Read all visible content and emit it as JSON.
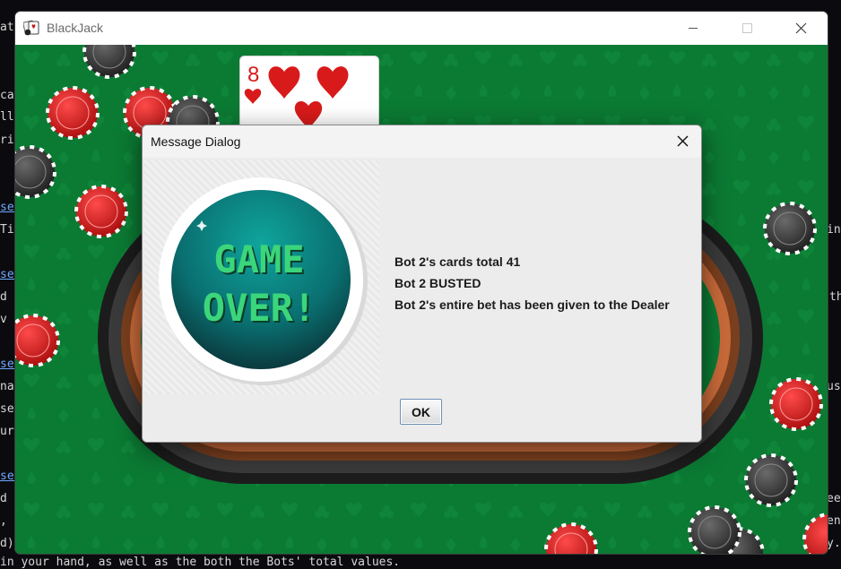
{
  "window": {
    "title": "BlackJack",
    "icon": "playing-cards-app-icon"
  },
  "background_text": [
    "at",
    "ca",
    "ll",
    "ric",
    "set",
    "Ti",
    "set",
    "d f",
    "v n",
    "set",
    "nat",
    "se",
    "urs",
    "set",
    "d i",
    ", u",
    "d)",
    "ing",
    "th",
    "usi",
    "eep",
    "ent",
    "y.",
    "in your hand, as well as the both the Bots' total values."
  ],
  "table": {
    "dealer_card": {
      "rank": "8",
      "suit": "hearts",
      "suit_color": "#d81a1a"
    }
  },
  "dialog": {
    "title": "Message Dialog",
    "badge_text": [
      "GAME",
      "OVER!"
    ],
    "messages": [
      "Bot 2's cards total 41",
      "Bot 2 BUSTED",
      "Bot 2's entire bet has been given to the Dealer"
    ],
    "ok_label": "OK"
  },
  "colors": {
    "felt": "#0b7a33",
    "rail": "#262626",
    "rail_inner": "#8a4a26",
    "chip_red": "#d11b1b",
    "chip_black": "#2f2f2f",
    "badge_teal": "#0a8e8a",
    "badge_text": "#3bd67b"
  }
}
